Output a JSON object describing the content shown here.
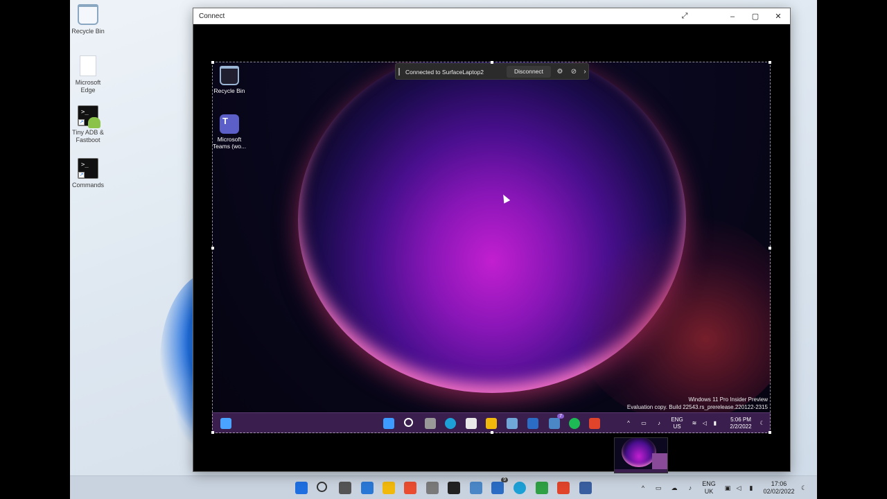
{
  "host_desktop": {
    "icons": [
      {
        "label": "Recycle Bin"
      },
      {
        "label": "Microsoft Edge"
      },
      {
        "label": "Tiny ADB & Fastboot"
      },
      {
        "label": "Commands"
      }
    ],
    "taskbar": {
      "language": {
        "line1": "ENG",
        "line2": "UK"
      },
      "clock": {
        "time": "17:06",
        "date": "02/02/2022"
      },
      "badge_count": "9"
    }
  },
  "window": {
    "title": "Connect"
  },
  "remote": {
    "connection_bar": {
      "status": "Connected to SurfaceLaptop2",
      "disconnect_label": "Disconnect"
    },
    "desktop_icons": [
      {
        "label": "Recycle Bin"
      },
      {
        "label": "Microsoft Teams (wo..."
      }
    ],
    "watermark": {
      "line1": "Windows 11 Pro Insider Preview",
      "line2": "Evaluation copy. Build 22543.rs_prerelease.220122-2315"
    },
    "taskbar": {
      "language": {
        "line1": "ENG",
        "line2": "US"
      },
      "clock": {
        "time": "5:06 PM",
        "date": "2/2/2022"
      },
      "badge_count": "7"
    }
  },
  "colors": {
    "host_taskbar": "#c9d3df",
    "remote_taskbar": "#3a1f4e",
    "accent_blue": "#1f6fe0",
    "orb_magenta": "#c21fd0"
  }
}
